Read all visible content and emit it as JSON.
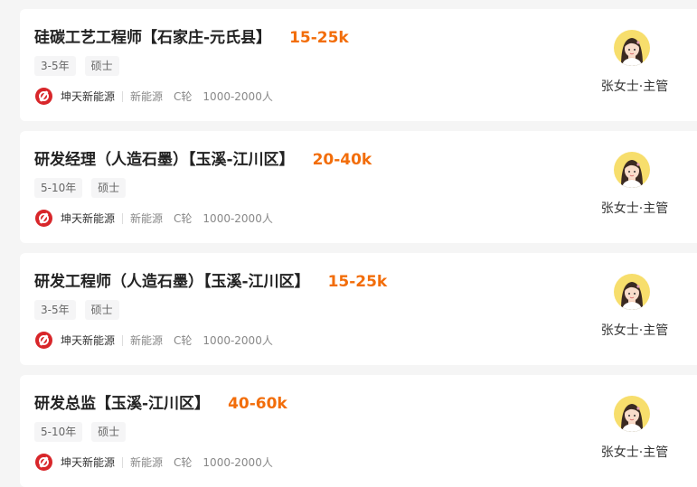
{
  "jobs": [
    {
      "title": "硅碳工艺工程师【石家庄-元氏县】",
      "salary": "15-25k",
      "tags": [
        "3-5年",
        "硕士"
      ],
      "company": "坤天新能源",
      "industry": "新能源",
      "funding": "C轮",
      "size": "1000-2000人",
      "recruiter": "张女士·主管"
    },
    {
      "title": "研发经理（人造石墨）【玉溪-江川区】",
      "salary": "20-40k",
      "tags": [
        "5-10年",
        "硕士"
      ],
      "company": "坤天新能源",
      "industry": "新能源",
      "funding": "C轮",
      "size": "1000-2000人",
      "recruiter": "张女士·主管"
    },
    {
      "title": "研发工程师（人造石墨）【玉溪-江川区】",
      "salary": "15-25k",
      "tags": [
        "3-5年",
        "硕士"
      ],
      "company": "坤天新能源",
      "industry": "新能源",
      "funding": "C轮",
      "size": "1000-2000人",
      "recruiter": "张女士·主管"
    },
    {
      "title": "研发总监【玉溪-江川区】",
      "salary": "40-60k",
      "tags": [
        "5-10年",
        "硕士"
      ],
      "company": "坤天新能源",
      "industry": "新能源",
      "funding": "C轮",
      "size": "1000-2000人",
      "recruiter": "张女士·主管"
    }
  ],
  "colors": {
    "salary": "#f26d0a",
    "logo": "#d8262a",
    "avatar_bg": "#f7de6c"
  },
  "icons": {
    "company_logo": "company-logo-icon",
    "avatar": "recruiter-avatar-icon"
  }
}
